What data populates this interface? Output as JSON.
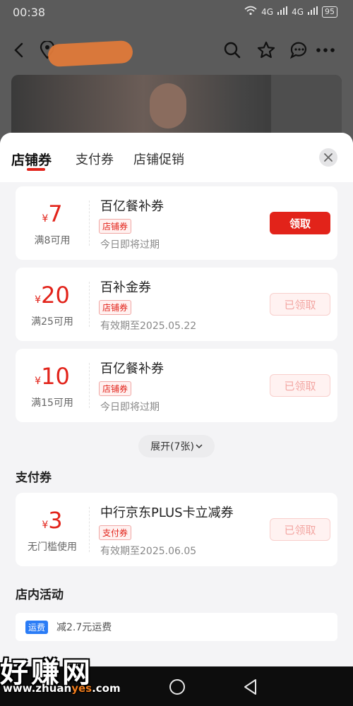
{
  "status_bar": {
    "time": "00:38",
    "network_1": "4G",
    "network_2": "4G",
    "battery": "95"
  },
  "top_nav": {
    "back_icon": "chevron-left-icon",
    "location_icon": "location-pin-icon",
    "search_icon": "search-icon",
    "favorite_icon": "star-icon",
    "chat_icon": "chat-bubble-icon",
    "more_icon": "more-dots-icon"
  },
  "sheet": {
    "tabs": [
      {
        "label": "店铺券"
      },
      {
        "label": "支付券"
      },
      {
        "label": "店铺促销"
      }
    ],
    "shop_coupons": [
      {
        "currency": "¥",
        "amount": "7",
        "condition": "满8可用",
        "title": "百亿餐补券",
        "badge": "店铺券",
        "expiry": "今日即将过期",
        "button": "领取"
      },
      {
        "currency": "¥",
        "amount": "20",
        "condition": "满25可用",
        "title": "百补金券",
        "badge": "店铺券",
        "expiry": "有效期至2025.05.22",
        "button": "已领取"
      },
      {
        "currency": "¥",
        "amount": "10",
        "condition": "满15可用",
        "title": "百亿餐补券",
        "badge": "店铺券",
        "expiry": "今日即将过期",
        "button": "已领取"
      }
    ],
    "expand_label": "展开(7张)",
    "payment_section_title": "支付券",
    "payment_coupons": [
      {
        "currency": "¥",
        "amount": "3",
        "condition": "无门槛使用",
        "title": "中行京东PLUS卡立减券",
        "badge": "支付券",
        "expiry": "有效期至2025.06.05",
        "button": "已领取"
      }
    ],
    "activity_section_title": "店内活动",
    "activities": [
      {
        "tag": "运费",
        "text": "减2.7元运费"
      }
    ]
  },
  "watermark": {
    "big": "好赚网",
    "url_prefix": "www.zhuan",
    "url_highlight": "yes",
    "url_suffix": ".com"
  },
  "colors": {
    "accent": "#e2231a",
    "claimed_text": "#f3a6a2",
    "activity_tag": "#2a7cf6"
  }
}
